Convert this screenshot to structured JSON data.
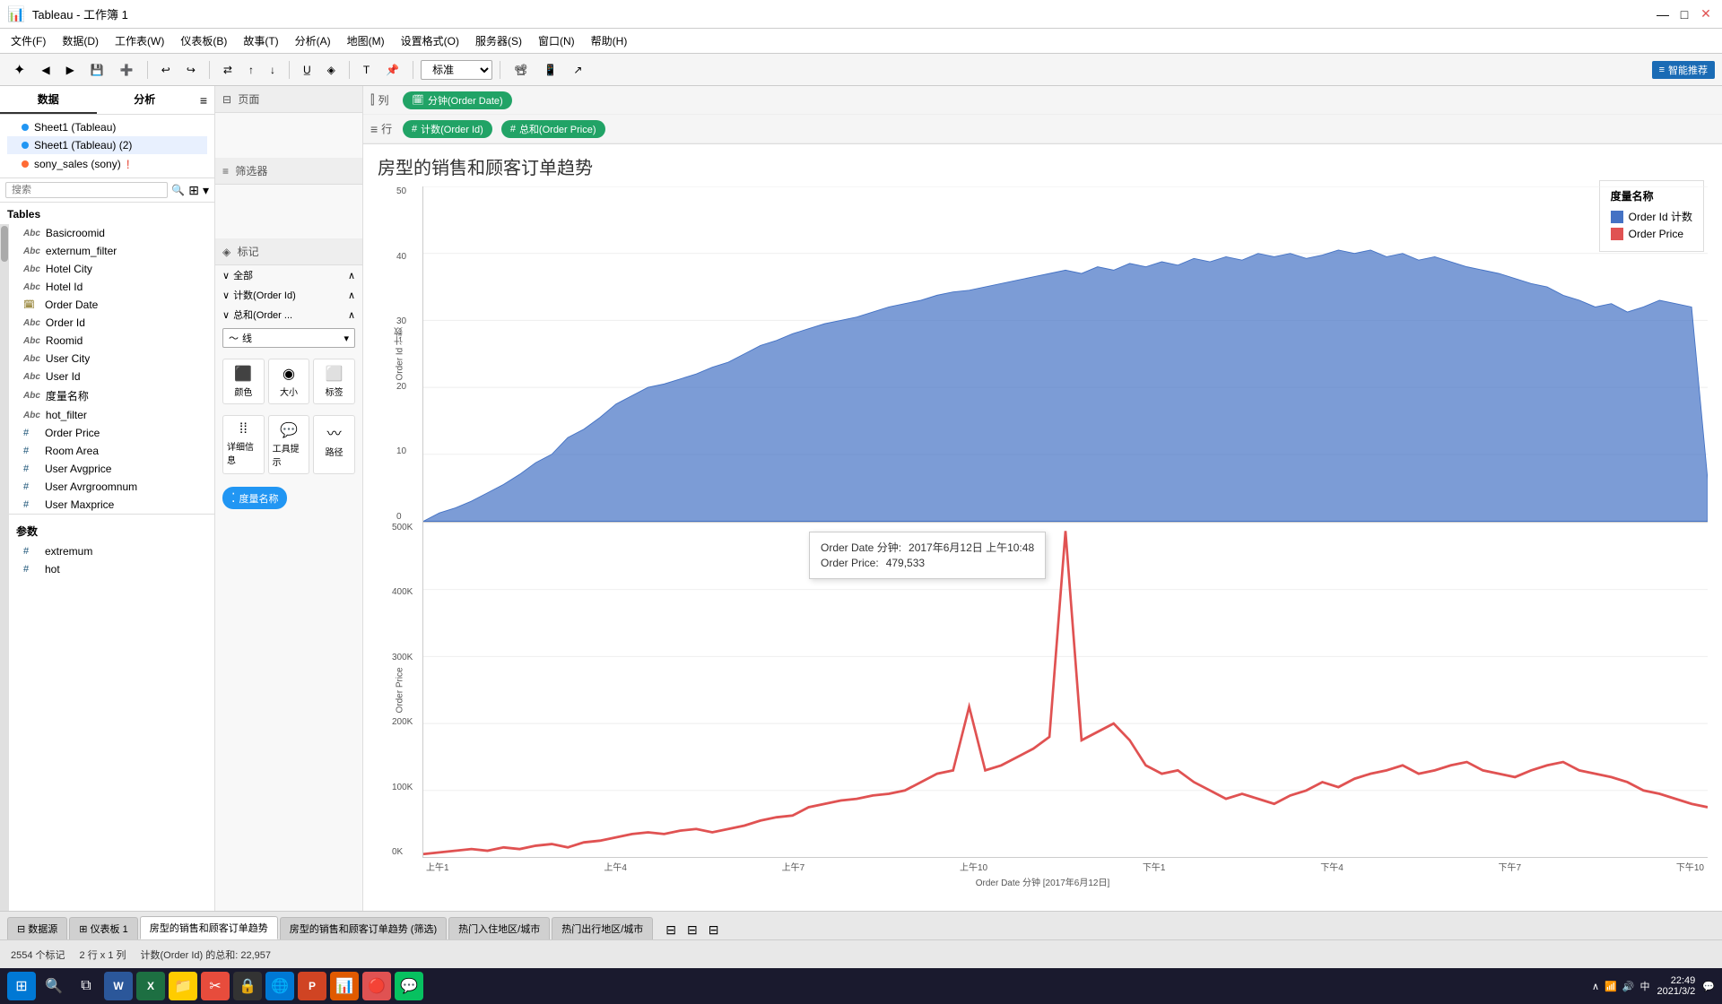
{
  "titlebar": {
    "title": "Tableau - 工作簿 1",
    "min": "—",
    "max": "□",
    "close": "✕"
  },
  "menubar": {
    "items": [
      "文件(F)",
      "数据(D)",
      "工作表(W)",
      "仪表板(B)",
      "故事(T)",
      "分析(A)",
      "地图(M)",
      "设置格式(O)",
      "服务器(S)",
      "窗口(N)",
      "帮助(H)"
    ]
  },
  "toolbar": {
    "standard_label": "标准",
    "smart_recommend": "智能推荐"
  },
  "left_panel": {
    "tab_data": "数据",
    "tab_analysis": "分析",
    "search_placeholder": "搜索",
    "tables_label": "Tables",
    "fields": [
      {
        "type": "abc",
        "name": "Basicroomid"
      },
      {
        "type": "abc",
        "name": "externum_filter"
      },
      {
        "type": "abc",
        "name": "Hotel City"
      },
      {
        "type": "abc",
        "name": "Hotel Id"
      },
      {
        "type": "cal",
        "name": "Order Date"
      },
      {
        "type": "abc",
        "name": "Order Id"
      },
      {
        "type": "abc",
        "name": "Roomid"
      },
      {
        "type": "abc",
        "name": "User City"
      },
      {
        "type": "abc",
        "name": "User Id"
      },
      {
        "type": "abc",
        "name": "度量名称"
      },
      {
        "type": "abc",
        "name": "hot_filter"
      },
      {
        "type": "hash",
        "name": "Order Price"
      },
      {
        "type": "hash",
        "name": "Room Area"
      },
      {
        "type": "hash",
        "name": "User Avgprice"
      },
      {
        "type": "hash",
        "name": "User Avrgroomnum"
      },
      {
        "type": "hash",
        "name": "User Maxprice"
      }
    ],
    "sources": [
      {
        "icon": "circle",
        "name": "Sheet1 (Tableau)"
      },
      {
        "icon": "circle",
        "name": "Sheet1 (Tableau) (2)"
      },
      {
        "icon": "circle",
        "name": "sony_sales (sony)",
        "warning": true
      }
    ],
    "params_label": "参数",
    "params": [
      {
        "type": "hash",
        "name": "extremum"
      },
      {
        "type": "hash",
        "name": "hot"
      }
    ]
  },
  "middle_panel": {
    "pages_label": "页面",
    "filters_label": "筛选器",
    "marks_label": "标记",
    "all_label": "全部",
    "order_id_label": "计数(Order Id)",
    "order_price_label": "总和(Order ...",
    "line_label": "线",
    "icon_labels": [
      "颜色",
      "大小",
      "标签",
      "详细信息",
      "工具提示",
      "路径"
    ],
    "measures_label": "度量名称"
  },
  "shelf": {
    "col_label": "列",
    "row_label": "行",
    "col_pill": "分钟(Order Date)",
    "row_pill1": "计数(Order Id)",
    "row_pill2": "总和(Order Price)"
  },
  "chart": {
    "title": "房型的销售和顾客订单趋势",
    "y1_label": "Order Id 计数",
    "y2_label": "Order Price",
    "x_label": "Order Date 分钟 [2017年6月12日]",
    "x_ticks": [
      "上午1",
      "上午4",
      "上午7",
      "上午10",
      "下午1",
      "下午4",
      "下午7",
      "下午10"
    ],
    "y1_ticks": [
      "0",
      "10",
      "20",
      "30",
      "40",
      "50"
    ],
    "y2_ticks": [
      "0K",
      "100K",
      "200K",
      "300K",
      "400K",
      "500K"
    ],
    "legend": {
      "title": "度量名称",
      "items": [
        {
          "color": "#4472C4",
          "label": "Order Id 计数"
        },
        {
          "color": "#E05252",
          "label": "Order Price"
        }
      ]
    },
    "tooltip": {
      "date_label": "Order Date 分钟:",
      "date_value": "2017年6月12日 上午10:48",
      "price_label": "Order Price:",
      "price_value": "479,533"
    }
  },
  "bottom_tabs": {
    "items": [
      "数据源",
      "仪表板 1",
      "房型的销售和顾客订单趋势",
      "房型的销售和顾客订单趋势 (筛选)",
      "热门入住地区/城市",
      "热门出行地区/城市"
    ]
  },
  "status_bar": {
    "marks": "2554 个标记",
    "rows_cols": "2 行 x 1 列",
    "summary": "计数(Order Id) 的总和: 22,957"
  },
  "taskbar": {
    "time": "22:49",
    "date": "2021/3/2",
    "apps": [
      "⊞",
      "🔍",
      "□",
      "W",
      "X",
      "📁",
      "✂",
      "🔒",
      "🌐",
      "P",
      "🔵",
      "🔴",
      "💬"
    ]
  }
}
